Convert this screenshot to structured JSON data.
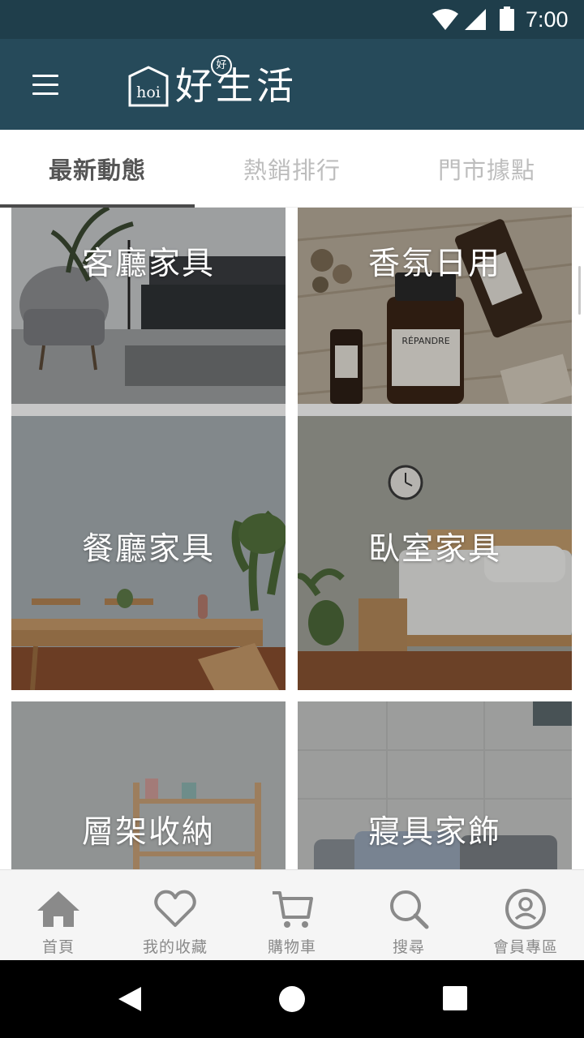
{
  "status_bar": {
    "time": "7:00",
    "icons": [
      "wifi-icon",
      "signal-icon",
      "battery-icon"
    ]
  },
  "app_bar": {
    "menu_icon": "hamburger-menu-icon",
    "logo": {
      "mark_text": "hoi",
      "badge_text": "好",
      "brand_text": "好生活"
    },
    "background_color": "#264a5a"
  },
  "tabs": [
    {
      "label": "最新動態",
      "active": true
    },
    {
      "label": "熱銷排行",
      "active": false
    },
    {
      "label": "門市據點",
      "active": false
    }
  ],
  "categories": [
    {
      "label": "客廳家具",
      "scene": "living-room"
    },
    {
      "label": "香氛日用",
      "scene": "fragrance"
    },
    {
      "label": "餐廳家具",
      "scene": "dining-room"
    },
    {
      "label": "臥室家具",
      "scene": "bedroom"
    },
    {
      "label": "層架收納",
      "scene": "shelf"
    },
    {
      "label": "寢具家飾",
      "scene": "bedding"
    }
  ],
  "product_text": {
    "bottle_brand": "RÉPANDRE"
  },
  "bottom_nav": [
    {
      "label": "首頁",
      "icon": "home-icon"
    },
    {
      "label": "我的收藏",
      "icon": "heart-icon"
    },
    {
      "label": "購物車",
      "icon": "cart-icon"
    },
    {
      "label": "搜尋",
      "icon": "search-icon"
    },
    {
      "label": "會員專區",
      "icon": "user-circle-icon"
    }
  ],
  "system_nav": [
    "back-icon",
    "home-circle-icon",
    "recents-icon"
  ],
  "colors": {
    "status_bar": "#1f3e4b",
    "app_bar": "#264a5a",
    "tab_active": "#555555",
    "tab_inactive": "#bdbdbd",
    "nav_icon": "#8a8a8a"
  }
}
